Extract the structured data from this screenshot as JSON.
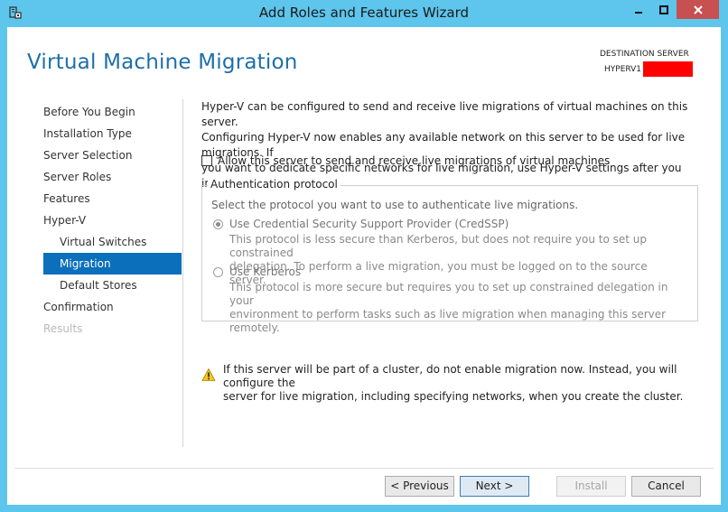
{
  "window": {
    "title": "Add Roles and Features Wizard"
  },
  "header": {
    "title": "Virtual Machine Migration",
    "destination_label": "DESTINATION SERVER",
    "destination_server": "HYPERV1"
  },
  "nav": {
    "items": [
      {
        "label": "Before You Begin",
        "sub": false,
        "state": "normal"
      },
      {
        "label": "Installation Type",
        "sub": false,
        "state": "normal"
      },
      {
        "label": "Server Selection",
        "sub": false,
        "state": "normal"
      },
      {
        "label": "Server Roles",
        "sub": false,
        "state": "normal"
      },
      {
        "label": "Features",
        "sub": false,
        "state": "normal"
      },
      {
        "label": "Hyper-V",
        "sub": false,
        "state": "normal"
      },
      {
        "label": "Virtual Switches",
        "sub": true,
        "state": "normal"
      },
      {
        "label": "Migration",
        "sub": true,
        "state": "active"
      },
      {
        "label": "Default Stores",
        "sub": true,
        "state": "normal"
      },
      {
        "label": "Confirmation",
        "sub": false,
        "state": "normal"
      },
      {
        "label": "Results",
        "sub": false,
        "state": "disabled"
      }
    ]
  },
  "content": {
    "intro_line1": "Hyper-V can be configured to send and receive live migrations of virtual machines on this server.",
    "intro_line2": "Configuring Hyper-V now enables any available network on this server to be used for live migrations. If",
    "intro_line3": "you want to dedicate specific networks for live migration, use Hyper-V settings after you install the role.",
    "allow_checkbox_label": "Allow this server to send and receive live migrations of virtual machines",
    "auth": {
      "legend": "Authentication protocol",
      "instruction": "Select the protocol you want to use to authenticate live migrations.",
      "credssp_label": "Use Credential Security Support Provider (CredSSP)",
      "credssp_desc_line1": "This protocol is less secure than Kerberos, but does not require you to set up constrained",
      "credssp_desc_line2": "delegation. To perform a live migration, you must be logged on to the source server.",
      "kerberos_label": "Use Kerberos",
      "kerberos_desc_line1": "This protocol is more secure but requires you to set up constrained delegation in your",
      "kerberos_desc_line2": "environment to perform tasks such as live migration when managing this server remotely."
    },
    "warning_line1": "If this server will be part of a cluster, do not enable migration now. Instead, you will configure the",
    "warning_line2": "server for live migration, including specifying networks, when you create the cluster."
  },
  "buttons": {
    "previous": "< Previous",
    "next": "Next >",
    "install": "Install",
    "cancel": "Cancel"
  },
  "colors": {
    "titlebar": "#5ec5ec",
    "accent_title": "#1d6fa9",
    "nav_active": "#0b6fbb",
    "close_button": "#c75050",
    "redaction": "#ff0000"
  }
}
